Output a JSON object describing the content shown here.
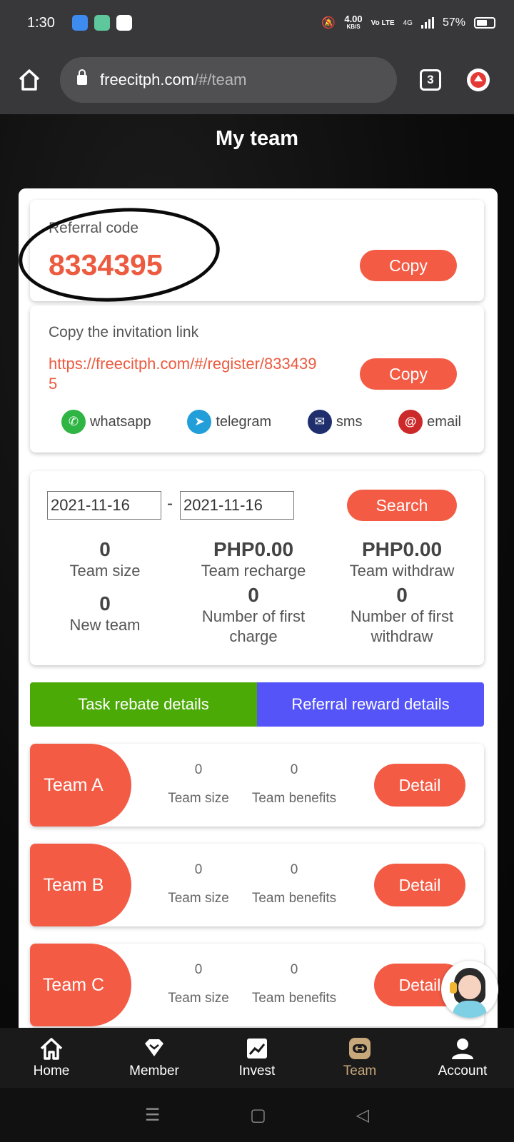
{
  "status_bar": {
    "time": "1:30",
    "net_speed": "4.00",
    "net_unit": "KB/S",
    "volte": "Vo LTE",
    "network": "4G",
    "battery": "57%"
  },
  "browser": {
    "url_host": "freecitph.com",
    "url_path": "/#/team",
    "tabs_count": "3"
  },
  "page": {
    "title": "My team"
  },
  "referral": {
    "label": "Referral code",
    "code": "8334395",
    "copy_label": "Copy"
  },
  "invitation": {
    "label": "Copy the invitation link",
    "link": "https://freecitph.com/#/register/8334395",
    "copy_label": "Copy",
    "share": [
      {
        "name": "whatsapp",
        "icon": "whatsapp-icon",
        "color": "#2fb544"
      },
      {
        "name": "telegram",
        "icon": "telegram-icon",
        "color": "#229ed9"
      },
      {
        "name": "sms",
        "icon": "sms-icon",
        "color": "#1f2f6e"
      },
      {
        "name": "email",
        "icon": "email-icon",
        "color": "#cc2a2a"
      }
    ]
  },
  "filter": {
    "start_date": "2021-11-16",
    "end_date": "2021-11-16",
    "separator": "-",
    "search_label": "Search"
  },
  "stats": [
    {
      "value": "0",
      "label": "Team size"
    },
    {
      "value": "PHP0.00",
      "label": "Team recharge"
    },
    {
      "value": "PHP0.00",
      "label": "Team withdraw"
    },
    {
      "value": "0",
      "label": "New team"
    },
    {
      "value": "0",
      "label": "Number of first charge"
    },
    {
      "value": "0",
      "label": "Number of first withdraw"
    }
  ],
  "tabs": [
    {
      "label": "Task rebate details",
      "color": "#4caa07"
    },
    {
      "label": "Referral reward details",
      "color": "#5454f8"
    }
  ],
  "teams": [
    {
      "name": "Team A",
      "size": "0",
      "size_label": "Team size",
      "benefits": "0",
      "benefits_label": "Team benefits",
      "detail_label": "Detail"
    },
    {
      "name": "Team B",
      "size": "0",
      "size_label": "Team size",
      "benefits": "0",
      "benefits_label": "Team benefits",
      "detail_label": "Detail"
    },
    {
      "name": "Team C",
      "size": "0",
      "size_label": "Team size",
      "benefits": "0",
      "benefits_label": "Team benefits",
      "detail_label": "Detail"
    }
  ],
  "bottom_nav": [
    {
      "label": "Home",
      "icon": "home-icon",
      "active": false
    },
    {
      "label": "Member",
      "icon": "member-icon",
      "active": false
    },
    {
      "label": "Invest",
      "icon": "invest-icon",
      "active": false
    },
    {
      "label": "Team",
      "icon": "team-icon",
      "active": true
    },
    {
      "label": "Account",
      "icon": "account-icon",
      "active": false
    }
  ],
  "colors": {
    "accent": "#f35b45",
    "code_red": "#ec5a3f",
    "nav_active": "#c7a87a"
  }
}
